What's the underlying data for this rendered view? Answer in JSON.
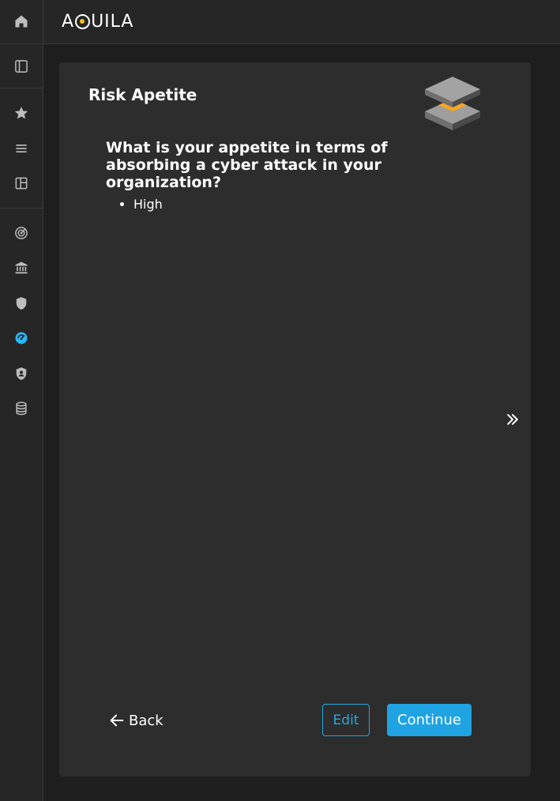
{
  "app": {
    "logo_text_before": "A",
    "logo_text_after": "UILA",
    "logo_full": "AQUILA"
  },
  "sidebar": {
    "items": [
      {
        "icon": "home-icon",
        "active": false
      },
      {
        "icon": "sidebar-panel-icon",
        "active": false
      },
      {
        "icon": "star-icon",
        "active": false
      },
      {
        "icon": "menu-list-icon",
        "active": false
      },
      {
        "icon": "layout-panel-icon",
        "active": false
      },
      {
        "icon": "radar-icon",
        "active": false
      },
      {
        "icon": "bank-icon",
        "active": false
      },
      {
        "icon": "shield-icon",
        "active": false
      },
      {
        "icon": "gauge-icon",
        "active": true
      },
      {
        "icon": "user-shield-icon",
        "active": false
      },
      {
        "icon": "database-icon",
        "active": false
      }
    ]
  },
  "card": {
    "title": "Risk Apetite",
    "question": "What is your appetite in terms of absorbing a cyber attack in your organization?",
    "answers": [
      "High"
    ]
  },
  "actions": {
    "back_label": "Back",
    "edit_label": "Edit",
    "continue_label": "Continue"
  },
  "colors": {
    "accent": "#1fa3e3",
    "sidebar_active_icon": "#29b6f6",
    "icon_gray": "#bdbdbd",
    "logo_dot": "#f5c518",
    "layers_highlight": "#f5a623"
  }
}
